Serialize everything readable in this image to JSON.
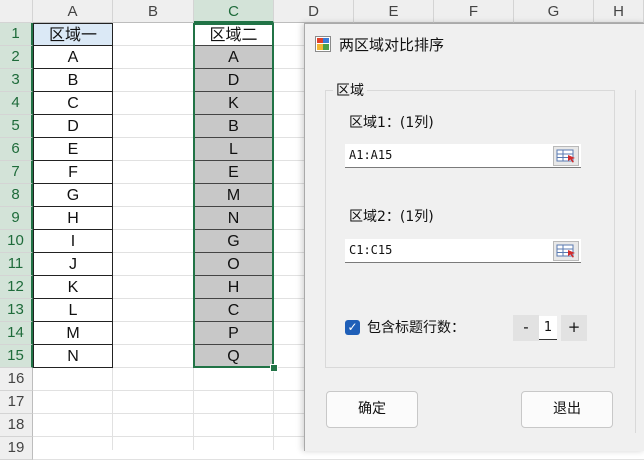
{
  "sheet": {
    "columns": [
      "A",
      "B",
      "C",
      "D",
      "E",
      "F",
      "G",
      "H"
    ],
    "rows": [
      "1",
      "2",
      "3",
      "4",
      "5",
      "6",
      "7",
      "8",
      "9",
      "10",
      "11",
      "12",
      "13",
      "14",
      "15",
      "16",
      "17",
      "18",
      "19"
    ],
    "col_a": [
      "区域一",
      "A",
      "B",
      "C",
      "D",
      "E",
      "F",
      "G",
      "H",
      "I",
      "J",
      "K",
      "L",
      "M",
      "N"
    ],
    "col_c": [
      "区域二",
      "A",
      "D",
      "K",
      "B",
      "L",
      "E",
      "M",
      "N",
      "G",
      "O",
      "H",
      "C",
      "P",
      "Q"
    ]
  },
  "dialog": {
    "title": "两区域对比排序",
    "group_label": "区域",
    "range1_label": "区域1：(1列)",
    "range1_value": "A1:A15",
    "range2_label": "区域2：(1列)",
    "range2_value": "C1:C15",
    "include_header_label": "包含标题行数：",
    "include_header_checked": true,
    "header_rows": "1",
    "minus": "-",
    "plus": "+",
    "ok": "确定",
    "exit": "退出"
  },
  "colors": {
    "selection": "#217346",
    "checkbox": "#1f5fb8",
    "highlight_fill": "#c8c8c8",
    "header_fill": "#dbe9f6"
  }
}
